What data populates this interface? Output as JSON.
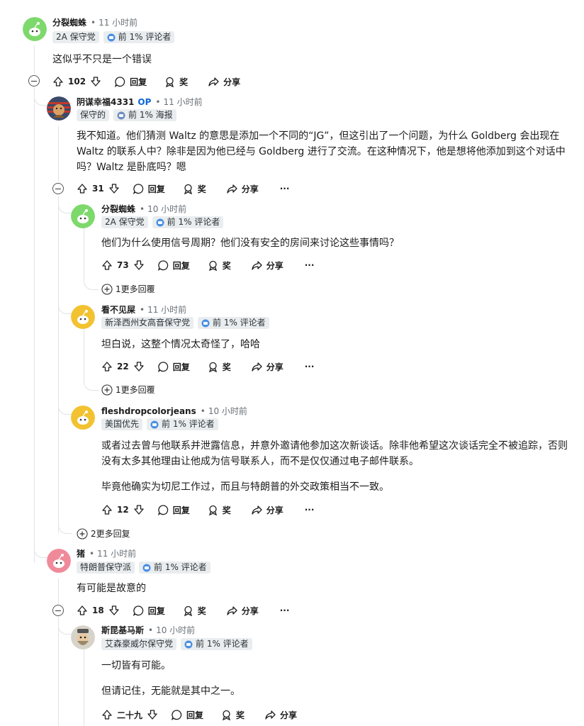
{
  "comments": [
    {
      "author": "分裂蜘蛛",
      "op": "",
      "time": "11 小时前",
      "flair": "2A 保守党",
      "badge": "前 1% 评论者",
      "body": [
        "这似乎不只是一个错误"
      ],
      "votes": "102",
      "reply": "回复",
      "award": "奖",
      "share": "分享",
      "more": "···",
      "avatar_color": "#7dd96b"
    },
    {
      "author": "阴谋幸福4331",
      "op": "OP",
      "time": "11 小时前",
      "flair": "保守的",
      "badge": "前 1% 海报",
      "body": [
        "我不知道。他们猜测 Waltz 的意思是添加一个不同的“JG”，但这引出了一个问题，为什么 Goldberg 会出现在 Waltz 的联系人中？除非是因为他已经与 Goldberg 进行了交流。在这种情况下，他是想将他添加到这个对话中吗？Waltz 是卧底吗？嗯"
      ],
      "votes": "31",
      "reply": "回复",
      "award": "奖",
      "share": "分享",
      "more": "···",
      "avatar_color": "#3b4a6b"
    },
    {
      "author": "分裂蜘蛛",
      "op": "",
      "time": "10 小时前",
      "flair": "2A 保守党",
      "badge": "前 1% 评论者",
      "body": [
        "他们为什么使用信号周期？他们没有安全的房间来讨论这些事情吗？"
      ],
      "votes": "73",
      "reply": "回复",
      "award": "奖",
      "share": "分享",
      "more": "···",
      "more_replies": "1更多回覆",
      "avatar_color": "#7dd96b"
    },
    {
      "author": "看不见屎",
      "op": "",
      "time": "11 小时前",
      "flair": "新泽西州女高音保守党",
      "badge": "前 1% 评论者",
      "body": [
        "坦白说，这整个情况太奇怪了，哈哈"
      ],
      "votes": "22",
      "reply": "回复",
      "award": "奖",
      "share": "分享",
      "more": "···",
      "more_replies": "1更多回覆",
      "avatar_color": "#f2c230"
    },
    {
      "author": "fleshdropcolorjeans",
      "op": "",
      "time": "10 小时前",
      "flair": "美国优先",
      "badge": "前 1% 评论者",
      "body": [
        "或者过去曾与他联系并泄露信息，并意外邀请他参加这次新谈话。除非他希望这次谈话完全不被追踪，否则没有太多其他理由让他成为信号联系人，而不是仅仅通过电子邮件联系。",
        "毕竟他确实为切尼工作过，而且与特朗普的外交政策相当不一致。"
      ],
      "votes": "12",
      "reply": "回复",
      "award": "奖",
      "share": "分享",
      "more": "···",
      "avatar_color": "#f2c230"
    },
    {
      "author": "猪",
      "op": "",
      "time": "11 小时前",
      "flair": "特朗普保守派",
      "badge": "前 1% 评论者",
      "body": [
        "有可能是故意的"
      ],
      "votes": "18",
      "reply": "回复",
      "award": "奖",
      "share": "分享",
      "more": "···",
      "avatar_color": "#f08a9a"
    },
    {
      "author": "斯昆基马斯",
      "op": "",
      "time": "10 小时前",
      "flair": "艾森豪威尔保守党",
      "badge": "前 1% 评论者",
      "body": [
        "一切皆有可能。",
        "但请记住，无能就是其中之一。"
      ],
      "votes": "二十九",
      "reply": "回复",
      "award": "奖",
      "share": "分享",
      "more": "",
      "avatar_color": "#d8d3c8"
    }
  ],
  "thread_more_replies": "2更多回复",
  "dot": "•",
  "icons": [
    "upvote-icon",
    "downvote-icon",
    "comment-icon",
    "award-icon",
    "share-icon",
    "plus-circle-icon",
    "minus-circle-icon",
    "badge-icon"
  ]
}
